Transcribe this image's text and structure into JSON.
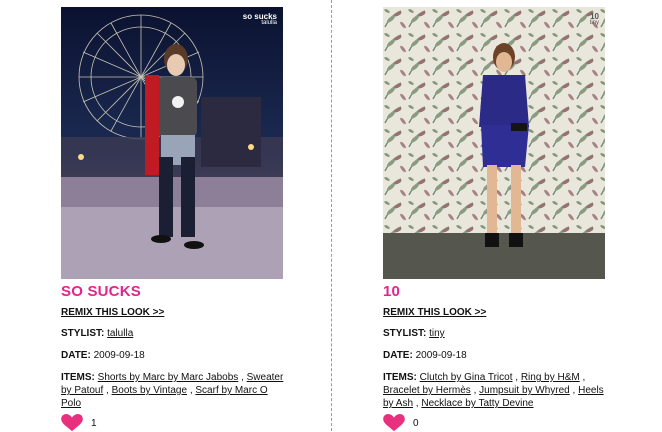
{
  "looks": [
    {
      "title": "SO SUCKS",
      "remix_label": "REMIX THIS LOOK >>",
      "stylist_label": "STYLIST:",
      "stylist": "talulla",
      "date_label": "DATE:",
      "date": "2009-09-18",
      "items_label": "ITEMS:",
      "items": [
        "Shorts by Marc by Marc Jabobs",
        "Sweater by Patouf",
        "Boots by Vintage",
        "Scarf by Marc O Polo"
      ],
      "likes": "1",
      "photo_caption": "so sucks"
    },
    {
      "title": "10",
      "remix_label": "REMIX THIS LOOK >>",
      "stylist_label": "STYLIST:",
      "stylist": "tiny",
      "date_label": "DATE:",
      "date": "2009-09-18",
      "items_label": "ITEMS:",
      "items": [
        "Clutch by Gina Tricot",
        "Ring by H&M",
        "Bracelet by Hermès",
        "Jumpsuit by Whyred",
        "Heels by Ash",
        "Necklace by Tatty Devine"
      ],
      "likes": "0",
      "photo_caption": "10"
    }
  ],
  "colors": {
    "accent": "#e0258b",
    "heart": "#e8307f"
  }
}
